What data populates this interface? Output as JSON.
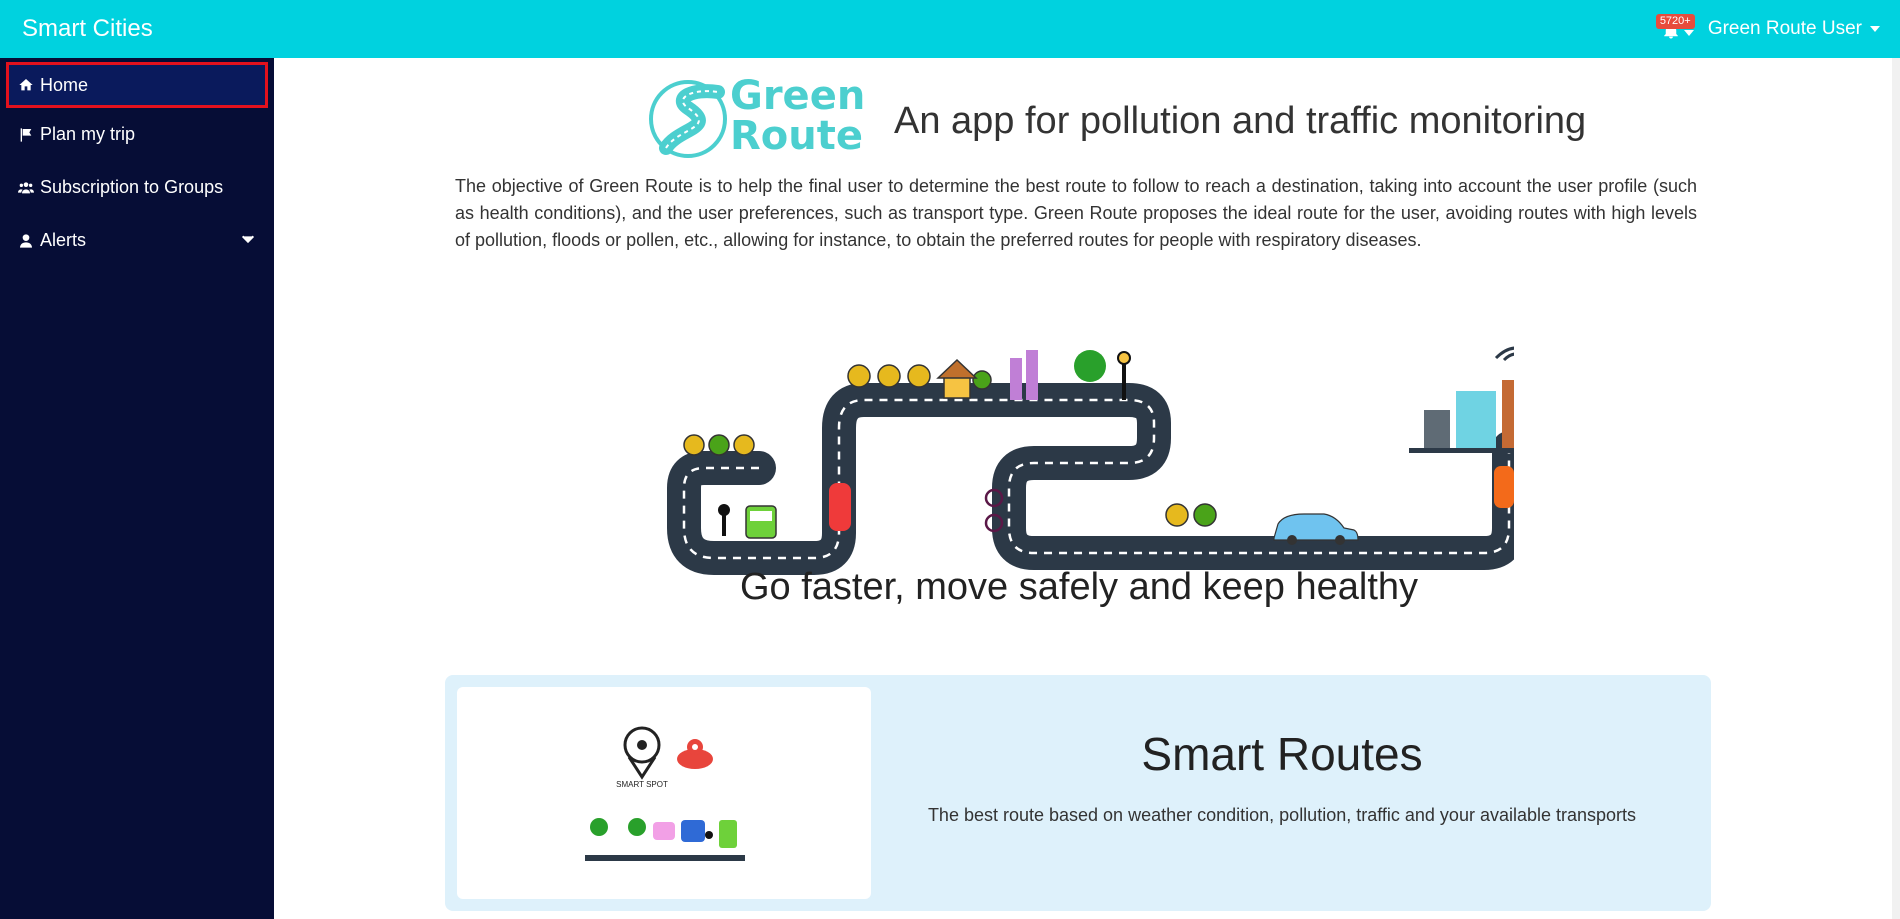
{
  "app": {
    "title": "Smart Cities"
  },
  "header": {
    "notification_count": "5720+",
    "user_name": "Green Route User"
  },
  "sidebar": {
    "items": [
      {
        "label": "Home",
        "icon": "home-icon",
        "active": true
      },
      {
        "label": "Plan my trip",
        "icon": "flag-icon"
      },
      {
        "label": "Subscription to Groups",
        "icon": "users-icon"
      },
      {
        "label": "Alerts",
        "icon": "user-icon",
        "expandable": true
      }
    ]
  },
  "main": {
    "logo_text_1": "Green",
    "logo_text_2": "Route",
    "headline": "An app for pollution and traffic monitoring",
    "description": "The objective of Green Route is to help the final user to determine the best route to follow to reach a destination, taking into account the user profile (such as health conditions), and the user preferences, such as transport type. Green Route proposes the ideal route for the user, avoiding routes with high levels of pollution, floods or pollen, etc., allowing for instance, to obtain the preferred routes for people with respiratory diseases.",
    "tagline": "Go faster, move safely and keep healthy",
    "card": {
      "title": "Smart Routes",
      "text": "The best route based on weather condition, pollution, traffic and your available transports",
      "image_caption": "SMART SPOT"
    }
  },
  "colors": {
    "topbar": "#00d2df",
    "sidebar": "#060d36",
    "active_border": "#e3111d",
    "card_bg": "#def1fb",
    "road": "#2c3947"
  }
}
